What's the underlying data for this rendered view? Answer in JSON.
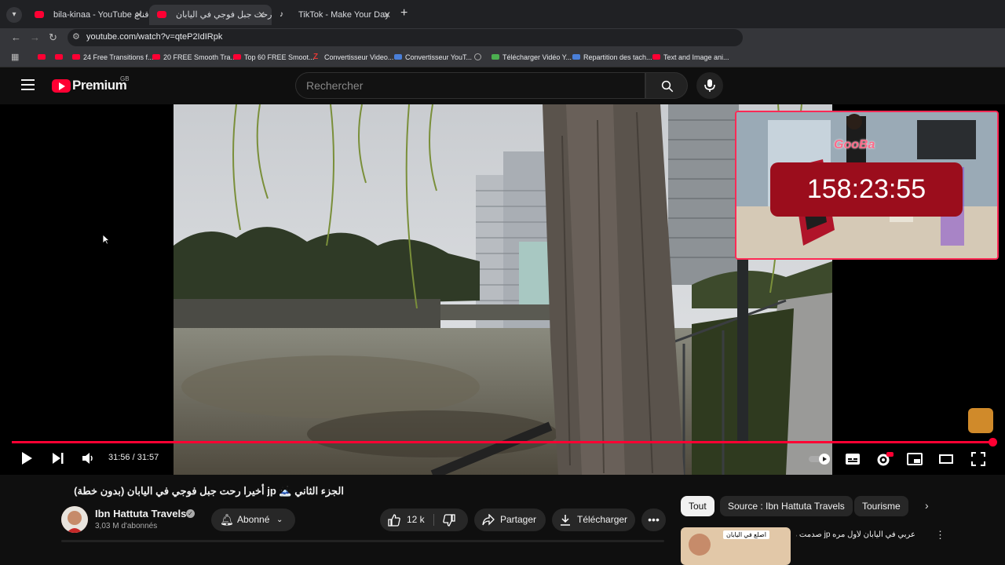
{
  "browser": {
    "tabs": [
      {
        "label": "bila-kinaa - YouTube بلا قناع",
        "active": false
      },
      {
        "label": "أخيرا رحت جبل فوجي في اليابان )",
        "active": true
      },
      {
        "label": "TikTok - Make Your Day",
        "active": false
      }
    ],
    "url": "youtube.com/watch?v=qteP2IdIRpk",
    "bookmarks": [
      {
        "label": "",
        "icon": "youtube"
      },
      {
        "label": "",
        "icon": "youtube"
      },
      {
        "label": "24 Free Transitions f...",
        "icon": "youtube"
      },
      {
        "label": "20 FREE Smooth Tra...",
        "icon": "youtube"
      },
      {
        "label": "Top 60 FREE Smoot...",
        "icon": "youtube"
      },
      {
        "label": "Convertisseur Video...",
        "icon": "z-logo"
      },
      {
        "label": "Convertisseur YouT...",
        "icon": "converter"
      },
      {
        "label": "",
        "icon": "globe"
      },
      {
        "label": "Télécharger Vidéo Y...",
        "icon": "download-green"
      },
      {
        "label": "Repartition des tach...",
        "icon": "doc-blue"
      },
      {
        "label": "Text and Image ani...",
        "icon": "youtube"
      }
    ]
  },
  "header": {
    "logo_text": "Premium",
    "region": "GB",
    "search_placeholder": "Rechercher"
  },
  "player": {
    "timer": "158:23:55",
    "streamer_tag": "GooBa",
    "time_display": "31:56 / 31:57",
    "progress": 0.999
  },
  "video": {
    "title": "الجزء الثاني 🗻 jp أخيرا رحت جبل فوجي في اليابان (بدون خطة)",
    "channel": "Ibn Hattuta Travels",
    "subscribers": "3,03 M d'abonnés",
    "subscribed_label": "Abonné",
    "likes": "12 k",
    "share_label": "Partager",
    "download_label": "Télécharger"
  },
  "filters": [
    "Tout",
    "Source : Ibn Hattuta Travels",
    "Tourisme"
  ],
  "recommendation": {
    "title": "عربي في اليابان لأول مره jp صدمت من",
    "thumb_text": "اصلع في اليابان"
  }
}
